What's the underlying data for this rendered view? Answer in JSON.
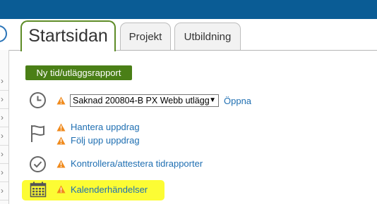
{
  "tabs": [
    {
      "label": "Startsidan",
      "active": true
    },
    {
      "label": "Projekt",
      "active": false
    },
    {
      "label": "Utbildning",
      "active": false
    }
  ],
  "actions": {
    "new_report_label": "Ny tid/utläggsrapport"
  },
  "missing_report": {
    "icon": "clock-icon",
    "selected_option": "Saknad 200804-B PX Webb utlägg",
    "open_label": "Öppna"
  },
  "assignments": {
    "icon": "flag-icon",
    "manage_label": "Hantera uppdrag",
    "follow_label": "Följ upp uppdrag"
  },
  "approval": {
    "icon": "checkmark-circle-icon",
    "label": "Kontrollera/attestera tidrapporter"
  },
  "calendar": {
    "icon": "calendar-icon",
    "label": "Kalenderhändelser",
    "highlight_color": "#fcfc34"
  },
  "colors": {
    "top_bar": "#0a5c95",
    "active_tab_border": "#5e8c27",
    "primary_button": "#4a7f16",
    "link": "#1f6fb2",
    "warning": "#f08a1c"
  }
}
